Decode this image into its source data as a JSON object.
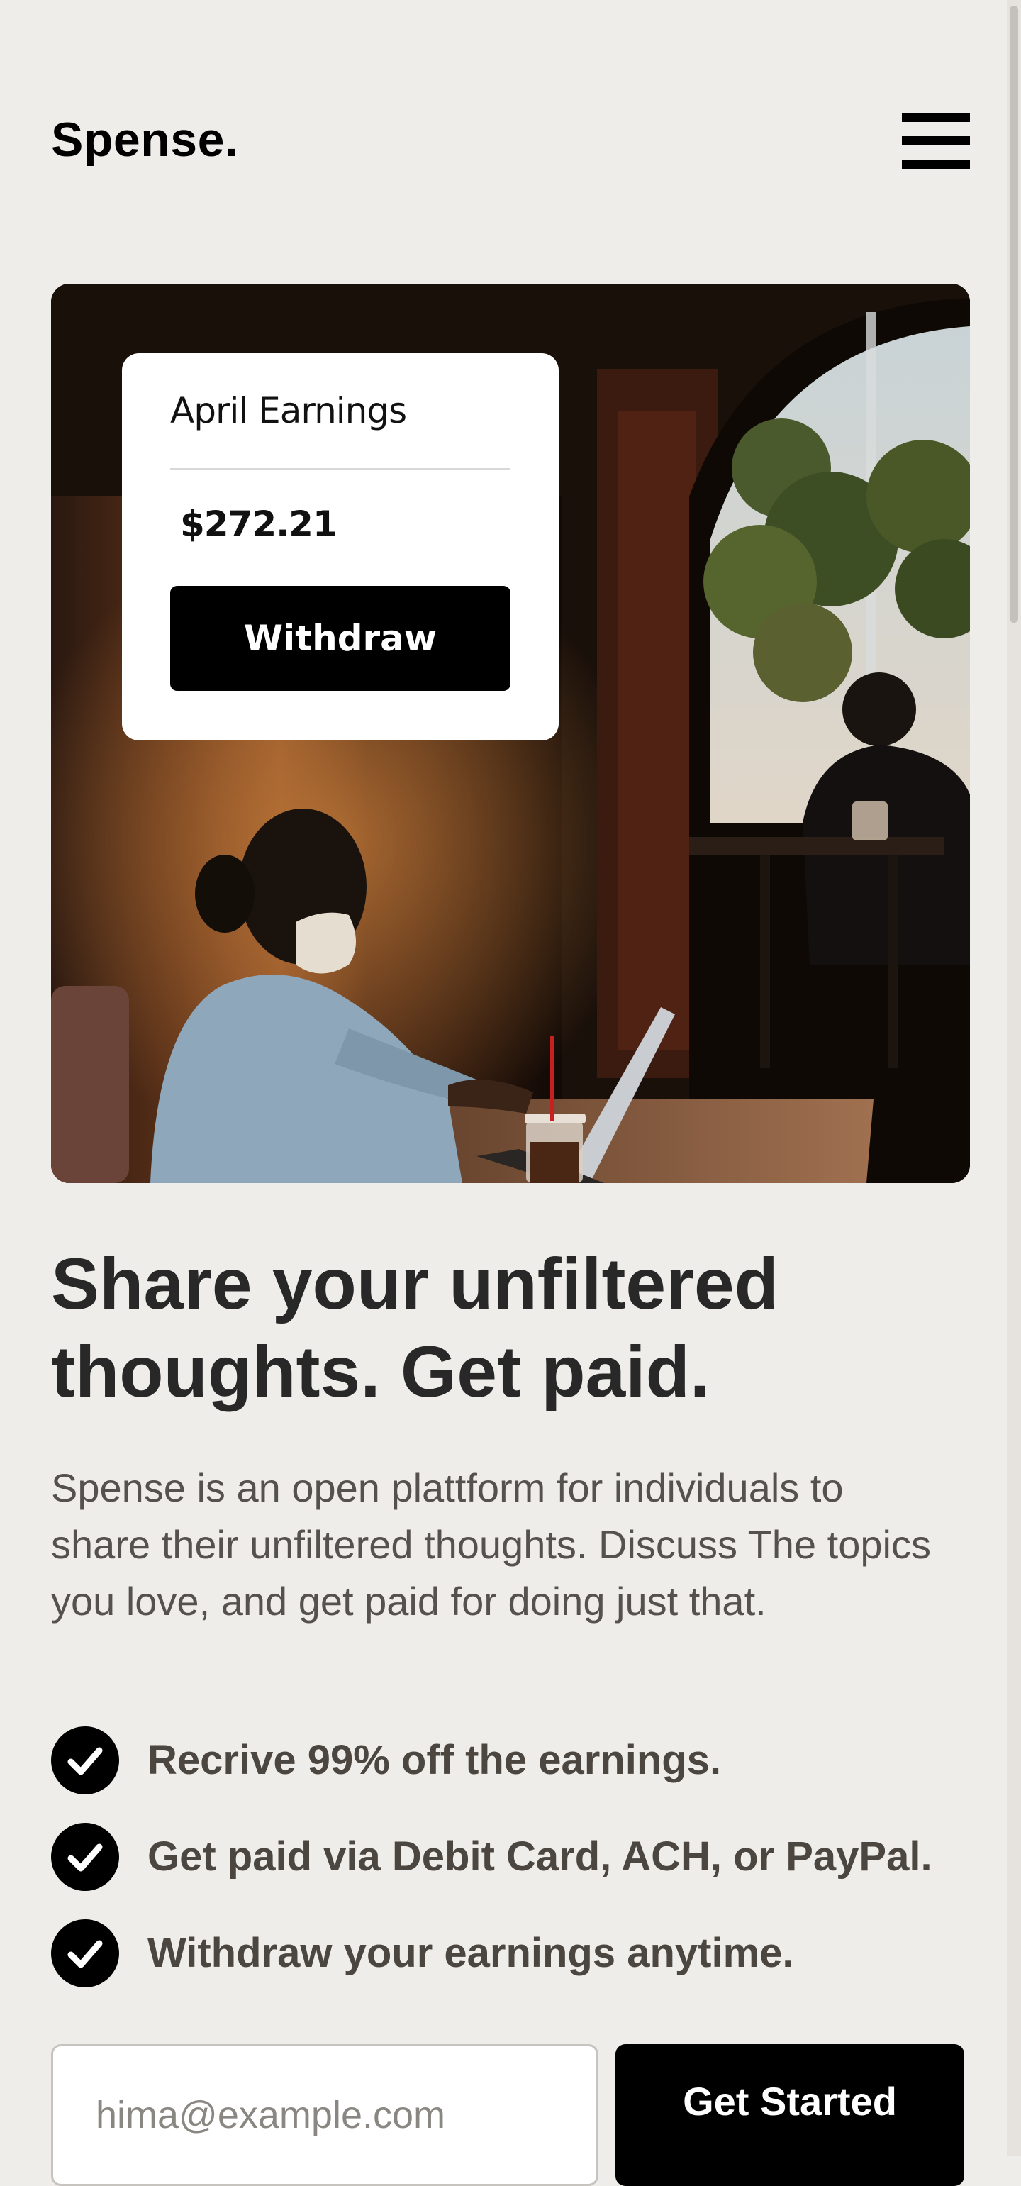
{
  "header": {
    "logo": "Spense.",
    "menu_icon": "hamburger-menu-icon"
  },
  "hero": {
    "image_description": "Woman wearing a face mask working on a laptop in a dimly lit café",
    "card": {
      "title": "April Earnings",
      "amount": "$272.21",
      "button_label": "Withdraw"
    }
  },
  "content": {
    "headline": "Share your unfiltered thoughts. Get paid.",
    "description": "Spense is an open plattform for individuals to share their unfiltered thoughts. Discuss The topics you love, and get paid for doing just that.",
    "features": [
      {
        "icon": "check-icon",
        "text": "Recrive 99% off the earnings."
      },
      {
        "icon": "check-icon",
        "text": "Get paid via Debit Card, ACH, or PayPal."
      },
      {
        "icon": "check-icon",
        "text": "Withdraw your earnings anytime."
      }
    ]
  },
  "signup": {
    "email_placeholder": "hima@example.com",
    "email_value": "",
    "button_label": "Get Started"
  },
  "colors": {
    "background": "#efedea",
    "primary": "#000000",
    "text": "#282828",
    "muted_text": "#55524e"
  }
}
